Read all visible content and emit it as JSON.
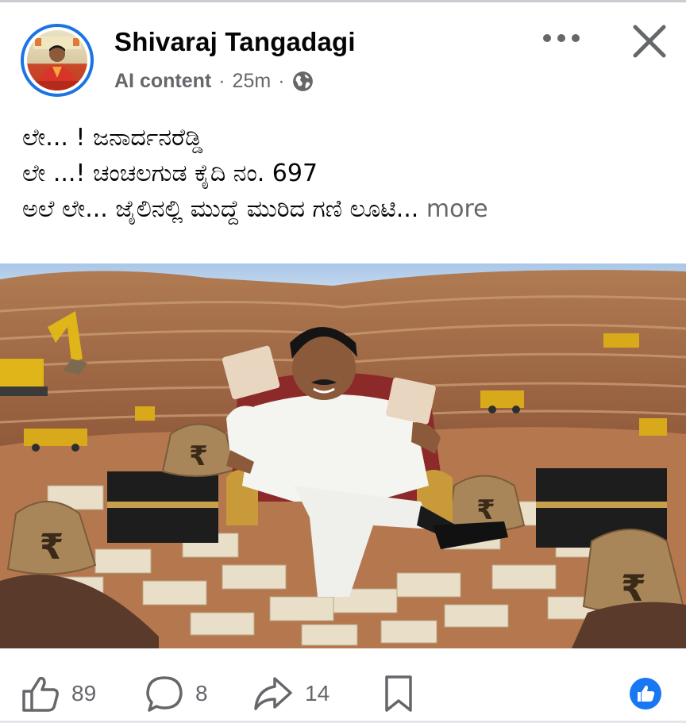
{
  "post": {
    "author": "Shivaraj Tangadagi",
    "label": "AI content",
    "separator": "·",
    "time": "25m",
    "audience_icon": "globe-icon",
    "text_lines": [
      "ಲೇ... ! ಜನಾರ್ದನರೆಡ್ಡಿ",
      "ಲೇ ...! ಚಂಚಲಗುಡ ಕೈದಿ ನಂ. 697",
      "ಅಲೆ ಲೇ... ಜೈಲಿನಲ್ಲಿ ಮುದ್ದೆ ಮುರಿದ ಗಣಿ ಲೂಟಿ..."
    ],
    "see_more": "more",
    "image_bag_symbol": "₹"
  },
  "header_icons": {
    "more": "more-horizontal-icon",
    "close": "close-icon"
  },
  "actions": {
    "like": {
      "icon": "thumbs-up-icon",
      "count": "89"
    },
    "comment": {
      "icon": "comment-icon",
      "count": "8"
    },
    "share": {
      "icon": "share-icon",
      "count": "14"
    },
    "save": {
      "icon": "bookmark-icon"
    },
    "reaction_badge": "like-reaction-icon"
  },
  "colors": {
    "brand_blue": "#1b74e4",
    "secondary_text": "#65676b",
    "primary_text": "#050505"
  }
}
